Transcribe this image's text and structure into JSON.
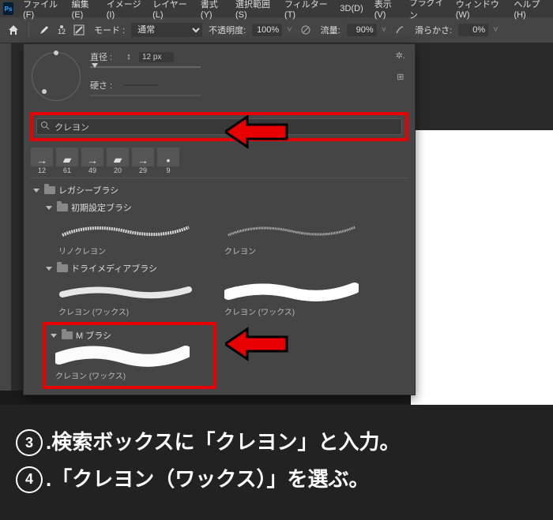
{
  "menubar": {
    "items": [
      "ファイル(F)",
      "編集(E)",
      "イメージ(I)",
      "レイヤー(L)",
      "書式(Y)",
      "選択範囲(S)",
      "フィルター(T)",
      "3D(D)",
      "表示(V)",
      "プラグイン",
      "ウィンドウ(W)",
      "ヘルプ(H)"
    ]
  },
  "toolbar": {
    "brush_size_num": "12",
    "mode_label": "モード :",
    "mode_value": "通常",
    "opacity_label": "不透明度:",
    "opacity_value": "100%",
    "flow_label": "流量:",
    "flow_value": "90%",
    "smooth_label": "滑らかさ:",
    "smooth_value": "0%"
  },
  "panel": {
    "diameter_label": "直径 :",
    "diameter_value": "12 px",
    "hardness_label": "硬さ :",
    "search_value": "クレヨン",
    "recent": [
      {
        "num": "12"
      },
      {
        "num": "61"
      },
      {
        "num": "49"
      },
      {
        "num": "20"
      },
      {
        "num": "29"
      },
      {
        "num": "9"
      }
    ],
    "folder_legacy": "レガシーブラシ",
    "folder_default": "初期設定ブラシ",
    "brush_linocrayon": "リノクレヨン",
    "brush_crayon": "クレヨン",
    "folder_drymedia": "ドライメディアブラシ",
    "brush_wax1": "クレヨン (ワックス)",
    "brush_wax2": "クレヨン (ワックス)",
    "folder_m": "M ブラシ",
    "brush_wax3": "クレヨン (ワックス)"
  },
  "caption": {
    "line3_num": "3",
    "line3_text": ".検索ボックスに「クレヨン」と入力。",
    "line4_num": "4",
    "line4_text": ".「クレヨン（ワックス）」を選ぶ。"
  }
}
